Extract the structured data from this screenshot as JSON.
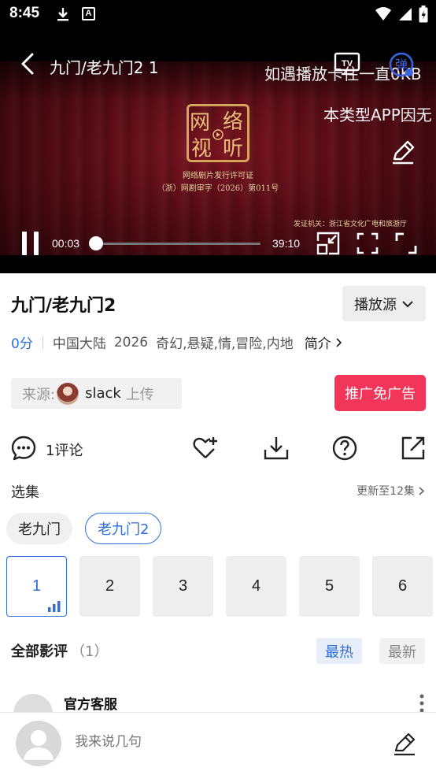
{
  "status_bar": {
    "time": "8:45",
    "a_icon": "A"
  },
  "player": {
    "title": "九门/老九门2 1",
    "danmaku": [
      "如遇播放卡住一直0KB",
      "本类型APP因无"
    ],
    "tv_label": "TV",
    "danmu_label": "弹",
    "seal_chars": [
      "网",
      "络",
      "视",
      "听"
    ],
    "license_line1": "网络剧片发行许可证",
    "license_line2": "（浙）网剧审字（2026）第011号",
    "authority": "发证机关：浙江省文化广电和旅游厅",
    "current_time": "00:03",
    "total_time": "39:10",
    "progress_fraction": 0.0013
  },
  "info": {
    "title": "九门/老九门2",
    "source_button": "播放源",
    "score": "0分",
    "region": "中国大陆",
    "year": "2026",
    "genres": "奇幻,悬疑,情,冒险,内地",
    "intro_link": "简介"
  },
  "uploader": {
    "label": "来源:",
    "name": "slack",
    "action": "上传"
  },
  "ad_button": "推广免广告",
  "actions": {
    "comment_count": "1评论"
  },
  "episodes": {
    "title": "选集",
    "updated": "更新至12集",
    "seasons": [
      {
        "label": "老九门",
        "active": false
      },
      {
        "label": "老九门2",
        "active": true
      }
    ],
    "items": [
      "1",
      "2",
      "3",
      "4",
      "5",
      "6"
    ]
  },
  "reviews": {
    "title": "全部影评",
    "count": "（1）",
    "sort_hot": "最热",
    "sort_new": "最新",
    "first_author": "官方客服"
  },
  "bottom": {
    "placeholder": "我来说几句"
  },
  "colors": {
    "accent": "#2e6fd8",
    "ad": "#f2365a",
    "curtain": "#5e0d16"
  }
}
